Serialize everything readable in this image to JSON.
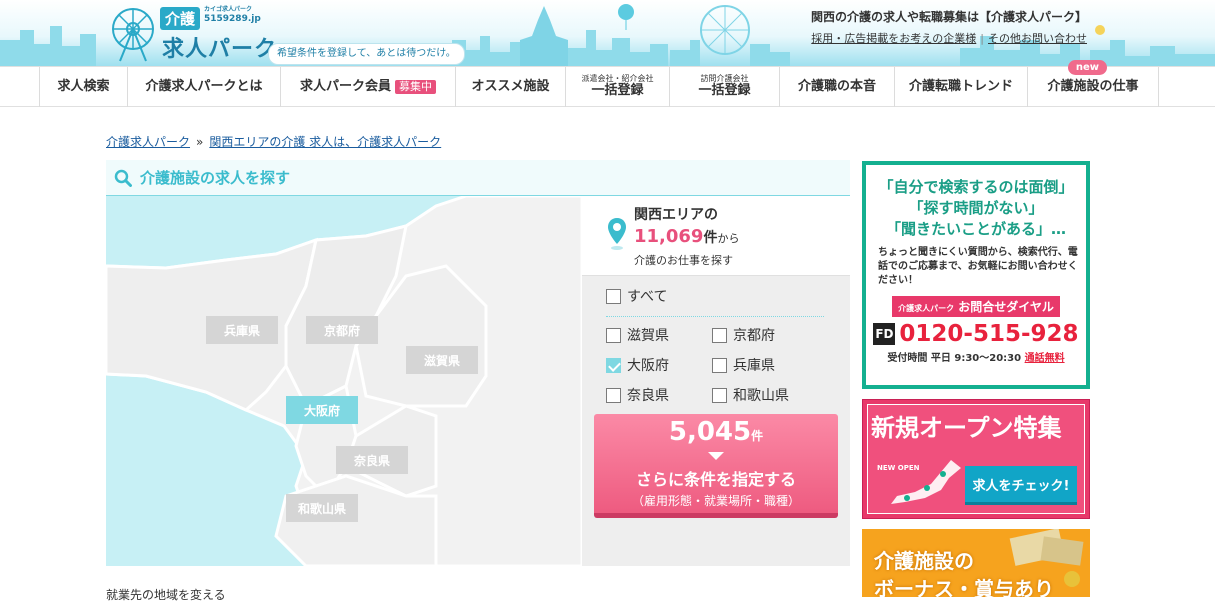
{
  "header": {
    "logo_top": "介護",
    "logo_small": "カイゴ求人パーク",
    "logo_url": "5159289.jp",
    "logo_main": "求人パーク",
    "tagline": "希望条件を登録して、あとは待つだけ。",
    "title": "関西の介護の求人や転職募集は【介護求人パーク】",
    "links": [
      "採用・広告掲載をお考えの企業様",
      "その他お問い合わせ"
    ]
  },
  "nav": {
    "items": [
      {
        "label": "求人検索"
      },
      {
        "label": "介護求人パークとは"
      },
      {
        "label": "求人パーク会員",
        "badge": "募集中"
      },
      {
        "label": "オススメ施設"
      },
      {
        "small": "派遣会社・紹介会社",
        "label": "一括登録"
      },
      {
        "small": "訪問介護会社",
        "label": "一括登録"
      },
      {
        "label": "介護職の本音"
      },
      {
        "label": "介護転職トレンド"
      },
      {
        "label": "介護施設の仕事",
        "new": "new"
      }
    ]
  },
  "breadcrumb": [
    "介護求人パーク",
    "関西エリアの介護 求人は、介護求人パーク"
  ],
  "breadcrumb_sep": "»",
  "search": {
    "title": "介護施設の求人を探す",
    "prefectures": {
      "hyogo": "兵庫県",
      "kyoto": "京都府",
      "shiga": "滋賀県",
      "osaka": "大阪府",
      "nara": "奈良県",
      "wakayama": "和歌山県"
    },
    "area_title": "関西エリアの",
    "area_count": "11,069",
    "area_count_unit": "件",
    "area_count_from": "から",
    "area_sub": "介護のお仕事を探す",
    "all_label": "すべて",
    "checks": [
      {
        "label": "滋賀県",
        "checked": false
      },
      {
        "label": "京都府",
        "checked": false
      },
      {
        "label": "大阪府",
        "checked": true
      },
      {
        "label": "兵庫県",
        "checked": false
      },
      {
        "label": "奈良県",
        "checked": false
      },
      {
        "label": "和歌山県",
        "checked": false
      }
    ],
    "cta_count": "5,045",
    "cta_unit": "件",
    "cta_main": "さらに条件を指定する",
    "cta_sub": "（雇用形態・就業場所・職種）"
  },
  "footer_text": "就業先の地域を変える",
  "ads": {
    "contact": {
      "q1": "「自分で検索するのは面倒」",
      "q2": "「探す時間がない」",
      "q3": "「聞きたいことがある」…",
      "body": "ちょっと聞きにくい質問から、検索代行、電話でのご応募まで、お気軽にお問い合わせください！",
      "pill_small": "介護求人パーク",
      "pill": "お問合せダイヤル",
      "fd": "FD",
      "tel": "0120-515-928",
      "hours": "受付時間 平日 9:30～20:30",
      "free": "通話無料"
    },
    "open": {
      "title": "新規オープン特集",
      "tag": "NEW OPEN",
      "button": "求人をチェック!"
    },
    "bonus": {
      "line1": "介護施設の",
      "line2": "ボーナス・賞与あり"
    }
  },
  "colors": {
    "accent": "#3bbccd",
    "pink": "#e8507c",
    "map_sea": "#c7f0f5",
    "map_land": "#f2f2f2"
  }
}
